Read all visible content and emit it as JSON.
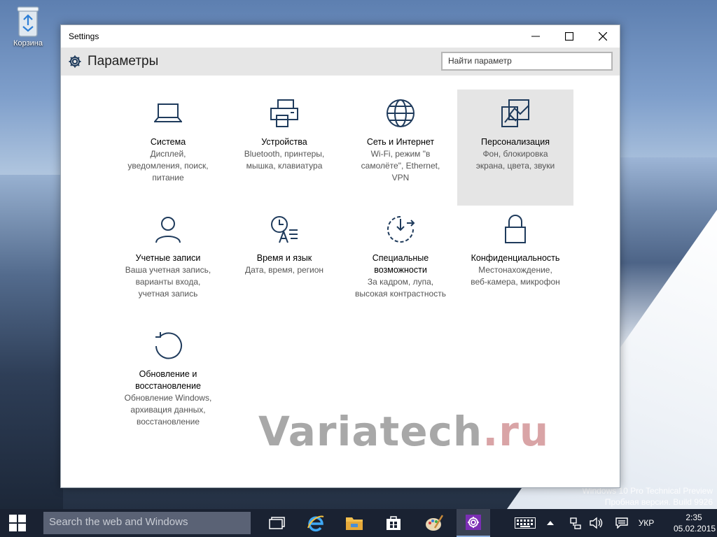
{
  "desktop": {
    "recycle_bin_label": "Корзина",
    "os_watermark_line1": "Windows 10 Pro Technical Preview",
    "os_watermark_line2": "Пробная версия. Build 9926"
  },
  "window": {
    "title": "Settings",
    "controls": [
      "minimize-icon",
      "maximize-icon",
      "close-icon"
    ]
  },
  "header": {
    "title": "Параметры",
    "search_placeholder": "Найти параметр"
  },
  "tiles": [
    {
      "name": "Система",
      "desc": [
        "Дисплей,",
        "уведомления, поиск,",
        "питание"
      ],
      "icon": "laptop-icon"
    },
    {
      "name": "Устройства",
      "desc": [
        "Bluetooth, принтеры,",
        "мышка, клавиатура"
      ],
      "icon": "printer-icon"
    },
    {
      "name": "Сеть и Интернет",
      "desc": [
        "Wi-Fi, режим \"в",
        "самолёте\", Ethernet,",
        "VPN"
      ],
      "icon": "globe-icon"
    },
    {
      "name": "Персонализация",
      "desc": [
        "Фон, блокировка",
        "экрана, цвета, звуки"
      ],
      "icon": "paint-icon",
      "selected": true
    },
    {
      "name": "Учетные записи",
      "desc": [
        "Ваша учетная запись,",
        "варианты входа,",
        "учетная запись"
      ],
      "icon": "person-icon"
    },
    {
      "name": "Время и язык",
      "desc": [
        "Дата, время, регион"
      ],
      "icon": "time-language-icon"
    },
    {
      "name": "Специальные\nвозможности",
      "desc": [
        "За кадром, лупа,",
        "высокая контрастность"
      ],
      "icon": "accessibility-icon"
    },
    {
      "name": "Конфиденциальность",
      "desc": [
        "Местонахождение,",
        "веб-камера, микрофон"
      ],
      "icon": "lock-icon"
    },
    {
      "name": "Обновление и\nвосстановление",
      "desc": [
        "Обновление Windows,",
        "архивация данных,",
        "восстановление"
      ],
      "icon": "update-icon"
    }
  ],
  "watermark": {
    "main": "Variatech",
    "suffix": ".ru"
  },
  "taskbar": {
    "search_placeholder": "Search the web and Windows",
    "apps": [
      "task-view-icon",
      "internet-explorer-icon",
      "file-explorer-icon",
      "store-icon",
      "paint-app-icon",
      "settings-icon"
    ],
    "language": "УКР",
    "time": "2:35",
    "date": "05.02.2015"
  }
}
